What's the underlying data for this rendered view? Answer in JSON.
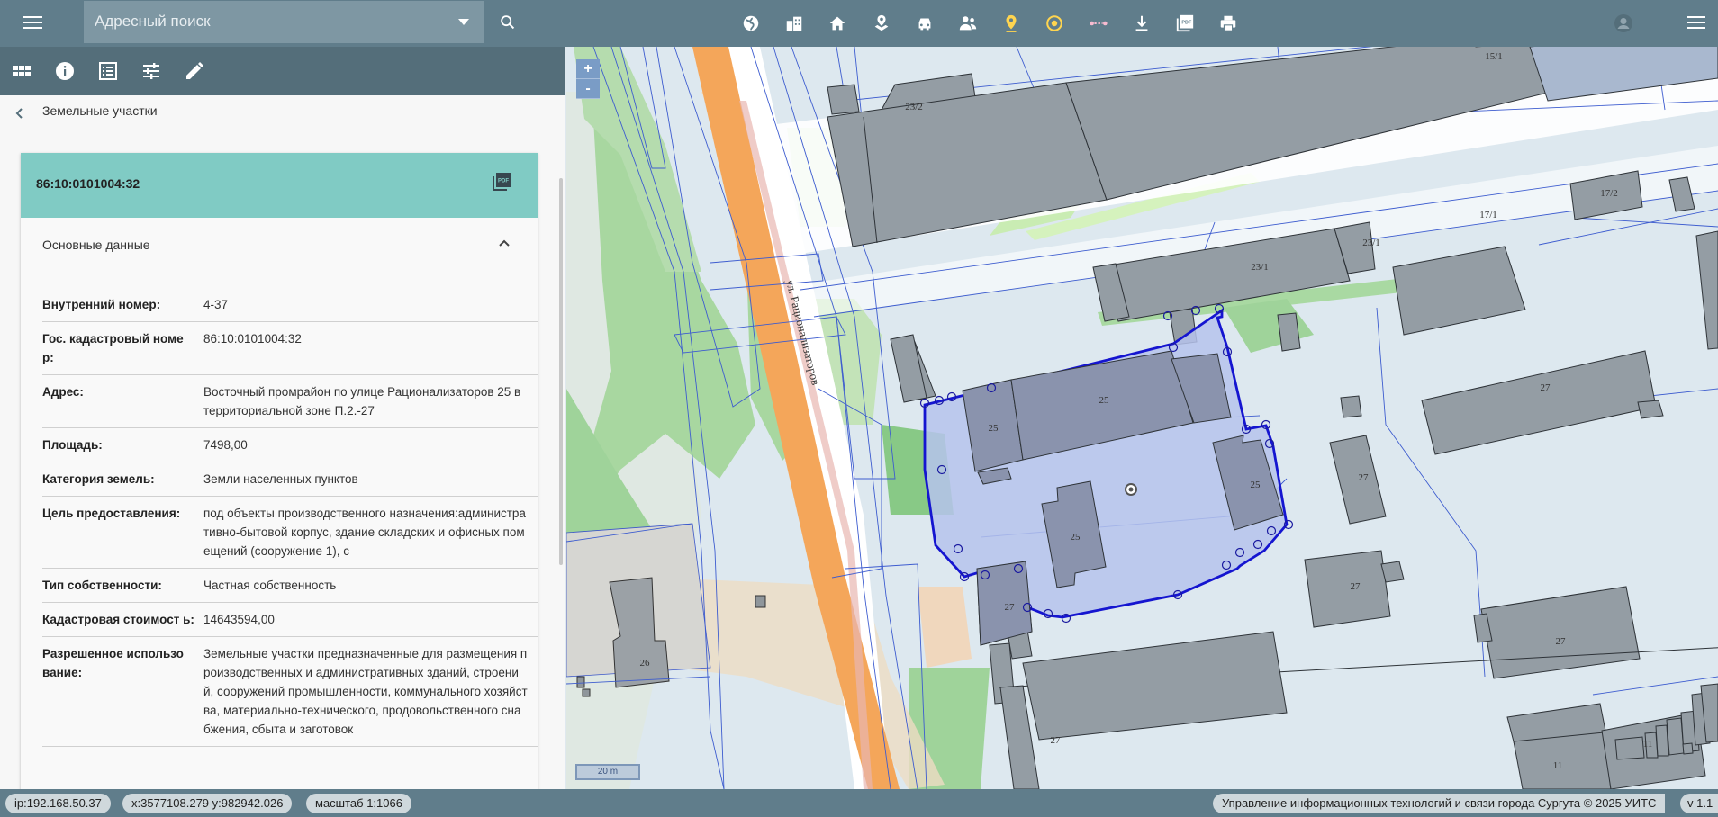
{
  "header": {
    "search_placeholder": "Адресный поиск",
    "icons": [
      "menu-icon",
      "globe-icon",
      "buildings-icon",
      "home-icon",
      "map-pin-layer-icon",
      "car-icon",
      "people-icon",
      "location-pin-icon",
      "target-icon",
      "measure-icon",
      "download-icon",
      "pdf-icon",
      "print-icon",
      "account-icon",
      "menu-icon"
    ]
  },
  "panel": {
    "breadcrumb": "Земельные участки",
    "card_title": "86:10:0101004:32",
    "section_title": "Основные данные",
    "rows": [
      {
        "key": "Внутренний номер:",
        "value": "4-37"
      },
      {
        "key": "Гос. кадастровый номе р:",
        "value": "86:10:0101004:32"
      },
      {
        "key": "Адрес:",
        "value": "Восточный промрайон по улице Рационализаторов 25 в территориальной зоне П.2.-27"
      },
      {
        "key": "Площадь:",
        "value": "7498,00"
      },
      {
        "key": "Категория земель:",
        "value": "Земли населенных пунктов"
      },
      {
        "key": "Цель предоставления:",
        "value": "под объекты производственного назначения:административно-бытовой корпус, здание складских и офисных помещений (сооружение 1), с"
      },
      {
        "key": "Тип собственности:",
        "value": "Частная собственность"
      },
      {
        "key": "Кадастровая стоимост ь:",
        "value": "14643594,00"
      },
      {
        "key": "Разрешенное использо вание:",
        "value": "Земельные участки предназначенные для размещения производственных и административных зданий, строений, сооружений промышленности, коммунального хозяйства, материально-технического, продовольственного снабжения, сбыта и заготовок"
      }
    ]
  },
  "map": {
    "street_label": "ул. Рационализаторов",
    "zoom_in": "+",
    "zoom_out": "-",
    "scale_label": "20 m",
    "labels": [
      "23/2",
      "15/1",
      "17/1",
      "17/2",
      "23/1",
      "23/1",
      "25",
      "25",
      "25",
      "25",
      "27",
      "27",
      "27",
      "27",
      "27",
      "27",
      "26",
      "11",
      "11"
    ],
    "colors": {
      "parcel_fill": "#b6c3ec",
      "parcel_line": "#1515d0",
      "building": "#8e9aa3",
      "road": "#f4a65a",
      "green": "#96cc8c"
    }
  },
  "status": {
    "ip": "ip:192.168.50.37",
    "coords": "x:3577108.279 y:982942.026",
    "scale": "масштаб 1:1066",
    "copyright": "Управление информационных технологий и связи города Сургута © 2025 УИТС",
    "version": "v 1.1"
  }
}
